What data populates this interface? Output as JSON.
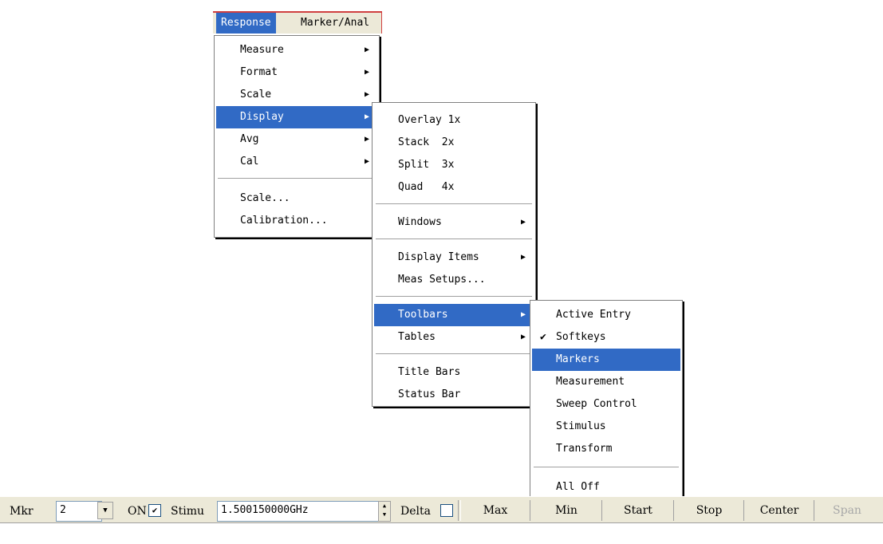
{
  "menubar": {
    "response": "Response",
    "marker": "Marker/Anal"
  },
  "response_menu": {
    "measure": "Measure",
    "format": "Format",
    "scale": "Scale",
    "display": "Display",
    "avg": "Avg",
    "cal": "Cal",
    "scale_dialog": "Scale...",
    "calibration": "Calibration..."
  },
  "display_menu": {
    "overlay": "Overlay 1x",
    "stack": "Stack  2x",
    "split": "Split  3x",
    "quad": "Quad   4x",
    "windows": "Windows",
    "display_items": "Display Items",
    "meas_setups": "Meas Setups...",
    "toolbars": "Toolbars",
    "tables": "Tables",
    "title_bars": "Title Bars",
    "status_bar": "Status Bar"
  },
  "toolbars_menu": {
    "active_entry": "Active Entry",
    "softkeys": "Softkeys",
    "markers": "Markers",
    "measurement": "Measurement",
    "sweep_control": "Sweep Control",
    "stimulus": "Stimulus",
    "transform": "Transform",
    "all_off": "All Off",
    "checked_item": "softkeys"
  },
  "toolbar": {
    "mkr_label": "Mkr",
    "mkr_value": "2",
    "on_label": "ON",
    "on_checked": true,
    "stimu_label": "Stimu",
    "stimu_value": "1.500150000GHz",
    "delta_label": "Delta",
    "delta_checked": false,
    "max": "Max",
    "min": "Min",
    "start": "Start",
    "stop": "Stop",
    "center": "Center",
    "span": "Span"
  },
  "colors": {
    "highlight": "#316ac5",
    "toolbar_bg": "#ece9d8"
  }
}
